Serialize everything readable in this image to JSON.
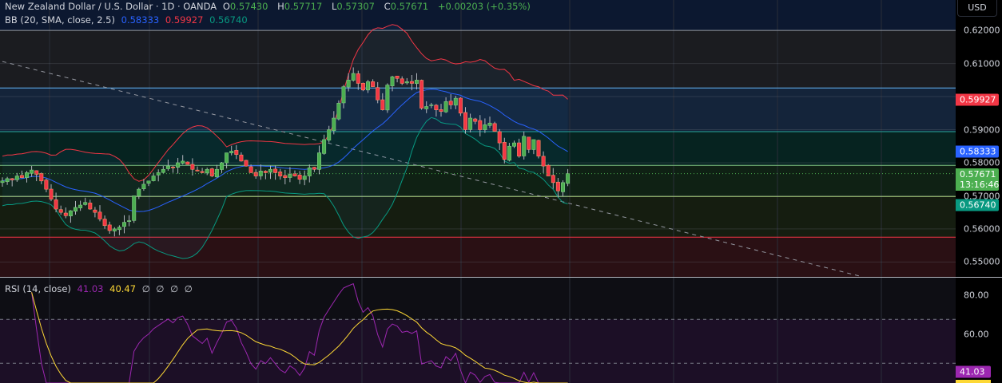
{
  "header": {
    "symbol": "New Zealand Dollar / U.S. Dollar · 1D · OANDA",
    "open_label": "O",
    "open": "0.57430",
    "high_label": "H",
    "high": "0.57717",
    "low_label": "L",
    "low": "0.57307",
    "close_label": "C",
    "close": "0.57671",
    "change": "+0.00203 (+0.35%)"
  },
  "bb_legend": {
    "name": "BB (20, SMA, close, 2.5)",
    "basis": "0.58333",
    "upper": "0.59927",
    "lower": "0.56740"
  },
  "rsi_legend": {
    "name": "RSI (14, close)",
    "rsi": "41.03",
    "ma": "40.47",
    "extras": [
      "∅",
      "∅",
      "∅",
      "∅"
    ]
  },
  "axis": {
    "currency": "USD",
    "price_ticks": [
      "0.62000",
      "0.61000",
      "0.59000",
      "0.58000",
      "0.57000",
      "0.56000",
      "0.55000"
    ],
    "rsi_ticks": [
      "80.00",
      "60.00"
    ],
    "labels": {
      "upper": "0.59927",
      "basis": "0.58333",
      "last": "0.57671",
      "countdown": "13:16:46",
      "lower": "0.56740",
      "rsi": "41.03"
    }
  },
  "colors": {
    "up": "#4caf50",
    "down": "#f23645",
    "basis": "#2962ff",
    "upper": "#f23645",
    "lower": "#089981",
    "rsi": "#9c27b0",
    "rsi_ma": "#fdd835"
  },
  "chart_data": {
    "type": "candlestick",
    "title": "New Zealand Dollar / U.S. Dollar · 1D · OANDA",
    "ylim": [
      0.5455,
      0.6292
    ],
    "closes": [
      0.5745,
      0.5752,
      0.5748,
      0.576,
      0.5755,
      0.577,
      0.5778,
      0.5765,
      0.5745,
      0.572,
      0.569,
      0.566,
      0.565,
      0.564,
      0.5655,
      0.5665,
      0.5672,
      0.568,
      0.566,
      0.565,
      0.563,
      0.561,
      0.5595,
      0.56,
      0.5605,
      0.562,
      0.5625,
      0.57,
      0.572,
      0.5735,
      0.5745,
      0.576,
      0.577,
      0.578,
      0.579,
      0.5785,
      0.58,
      0.5805,
      0.5795,
      0.578,
      0.5775,
      0.577,
      0.578,
      0.576,
      0.578,
      0.58,
      0.583,
      0.5835,
      0.5825,
      0.5805,
      0.579,
      0.577,
      0.576,
      0.5775,
      0.577,
      0.578,
      0.577,
      0.576,
      0.5755,
      0.5765,
      0.576,
      0.575,
      0.576,
      0.5785,
      0.578,
      0.583,
      0.587,
      0.59,
      0.5935,
      0.598,
      0.603,
      0.605,
      0.607,
      0.604,
      0.602,
      0.6045,
      0.603,
      0.599,
      0.596,
      0.6035,
      0.606,
      0.6055,
      0.604,
      0.6045,
      0.604,
      0.605,
      0.5965,
      0.597,
      0.5975,
      0.596,
      0.5955,
      0.5985,
      0.5975,
      0.5995,
      0.595,
      0.59,
      0.5935,
      0.5925,
      0.59,
      0.5915,
      0.592,
      0.5895,
      0.586,
      0.581,
      0.585,
      0.586,
      0.582,
      0.588,
      0.584,
      0.587,
      0.582,
      0.579,
      0.576,
      0.574,
      0.5715,
      0.574,
      0.57671
    ],
    "horizontal_levels": [
      {
        "price": 0.62,
        "color": "#9598a1"
      },
      {
        "price": 0.6026,
        "color": "#64b5f6"
      },
      {
        "price": 0.5894,
        "color": "#26a69a"
      },
      {
        "price": 0.5792,
        "color": "#81c784"
      },
      {
        "price": 0.5698,
        "color": "#aed581"
      },
      {
        "price": 0.5575,
        "color": "#f23645"
      }
    ],
    "zones": [
      {
        "from": 0.6292,
        "to": 0.62,
        "color": "#0c1830"
      },
      {
        "from": 0.62,
        "to": 0.6026,
        "color": "#1b1c20"
      },
      {
        "from": 0.6026,
        "to": 0.5894,
        "color": "#14243a"
      },
      {
        "from": 0.5894,
        "to": 0.5792,
        "color": "#062320"
      },
      {
        "from": 0.5792,
        "to": 0.5698,
        "color": "#0f2114"
      },
      {
        "from": 0.5698,
        "to": 0.5575,
        "color": "#151d10"
      },
      {
        "from": 0.5575,
        "to": 0.5455,
        "color": "#2a1014"
      }
    ],
    "trendline": {
      "from": [
        0,
        0.6106
      ],
      "to": [
        176,
        0.5457
      ]
    },
    "bb": {
      "length": 20,
      "mult": 2.5
    },
    "rsi": {
      "length": 14,
      "ma_length": 14,
      "ylim": [
        41,
        89
      ],
      "levels": [
        70,
        50
      ]
    }
  }
}
